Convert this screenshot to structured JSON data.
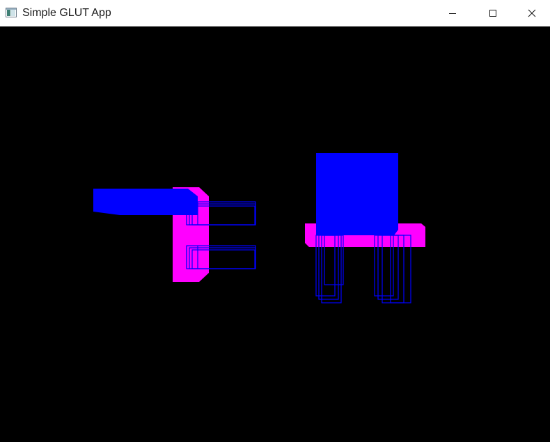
{
  "window": {
    "title": "Simple GLUT App",
    "controls": {
      "minimize_icon": "minimize-icon",
      "maximize_icon": "maximize-icon",
      "close_icon": "close-icon"
    }
  },
  "viewport": {
    "background": "#000000",
    "colors": {
      "solid_blue": "#0000ff",
      "magenta": "#ff00ff",
      "wire_blue": "#0000ff"
    }
  }
}
